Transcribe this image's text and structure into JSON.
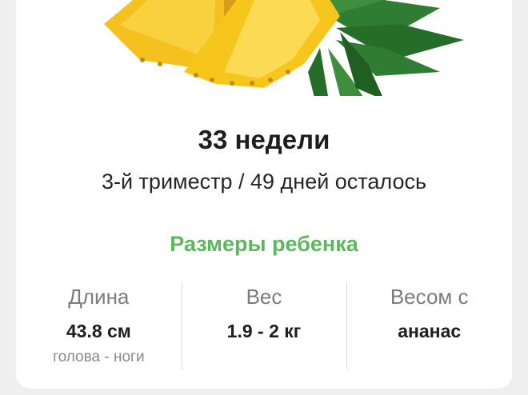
{
  "week": {
    "title": "33 недели",
    "subtitle": "3-й триместр / 49 дней осталось"
  },
  "baby_size": {
    "section_title": "Размеры ребенка",
    "stats": [
      {
        "label": "Длина",
        "value": "43.8 см",
        "note": "голова - ноги"
      },
      {
        "label": "Вес",
        "value": "1.9 - 2 кг",
        "note": ""
      },
      {
        "label": "Весом с",
        "value": "ананас",
        "note": ""
      }
    ]
  },
  "illustration": {
    "icon": "pineapple-illustration",
    "colors": {
      "flesh": "#f7c21a",
      "rind": "#e8a416",
      "leaves": "#2f7d32"
    }
  }
}
